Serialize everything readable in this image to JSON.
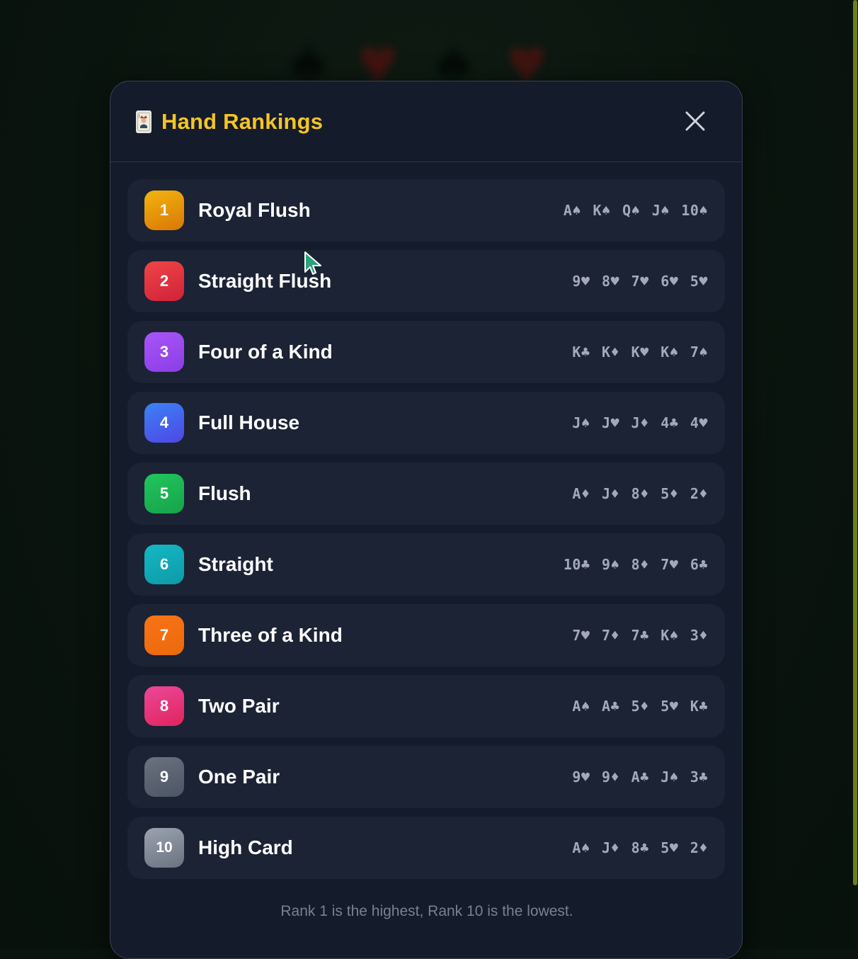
{
  "background": {
    "suits": [
      "♠",
      "♥",
      "♠",
      "♥"
    ]
  },
  "modal": {
    "title": "Hand Rankings",
    "title_icon": "joker-card-icon",
    "close_icon": "close-icon",
    "footer": "Rank 1 is the highest, Rank 10 is the lowest."
  },
  "hands": [
    {
      "rank": "1",
      "name": "Royal Flush",
      "cards": "A♠ K♠ Q♠ J♠ 10♠",
      "color_from": "#f2b50f",
      "color_to": "#d97706"
    },
    {
      "rank": "2",
      "name": "Straight Flush",
      "cards": "9♥ 8♥ 7♥ 6♥ 5♥",
      "color_from": "#f04545",
      "color_to": "#d0223a"
    },
    {
      "rank": "3",
      "name": "Four of a Kind",
      "cards": "K♣ K♦ K♥ K♠ 7♠",
      "color_from": "#a855f7",
      "color_to": "#8b3ee6"
    },
    {
      "rank": "4",
      "name": "Full House",
      "cards": "J♠ J♥ J♦ 4♣ 4♥",
      "color_from": "#3b82f6",
      "color_to": "#4f46e5"
    },
    {
      "rank": "5",
      "name": "Flush",
      "cards": "A♦ J♦ 8♦ 5♦ 2♦",
      "color_from": "#22c55e",
      "color_to": "#16a34a"
    },
    {
      "rank": "6",
      "name": "Straight",
      "cards": "10♣ 9♠ 8♦ 7♥ 6♣",
      "color_from": "#14b8c4",
      "color_to": "#0e9aa8"
    },
    {
      "rank": "7",
      "name": "Three of a Kind",
      "cards": "7♥ 7♦ 7♣ K♠ 3♦",
      "color_from": "#f97316",
      "color_to": "#ea6a0c"
    },
    {
      "rank": "8",
      "name": "Two Pair",
      "cards": "A♠ A♣ 5♦ 5♥ K♣",
      "color_from": "#ec4899",
      "color_to": "#e0245e"
    },
    {
      "rank": "9",
      "name": "One Pair",
      "cards": "9♥ 9♦ A♣ J♠ 3♣",
      "color_from": "#6b7280",
      "color_to": "#4b5563"
    },
    {
      "rank": "10",
      "name": "High Card",
      "cards": "A♠ J♦ 8♣ 5♥ 2♦",
      "color_from": "#9ca3af",
      "color_to": "#6b7280"
    }
  ]
}
